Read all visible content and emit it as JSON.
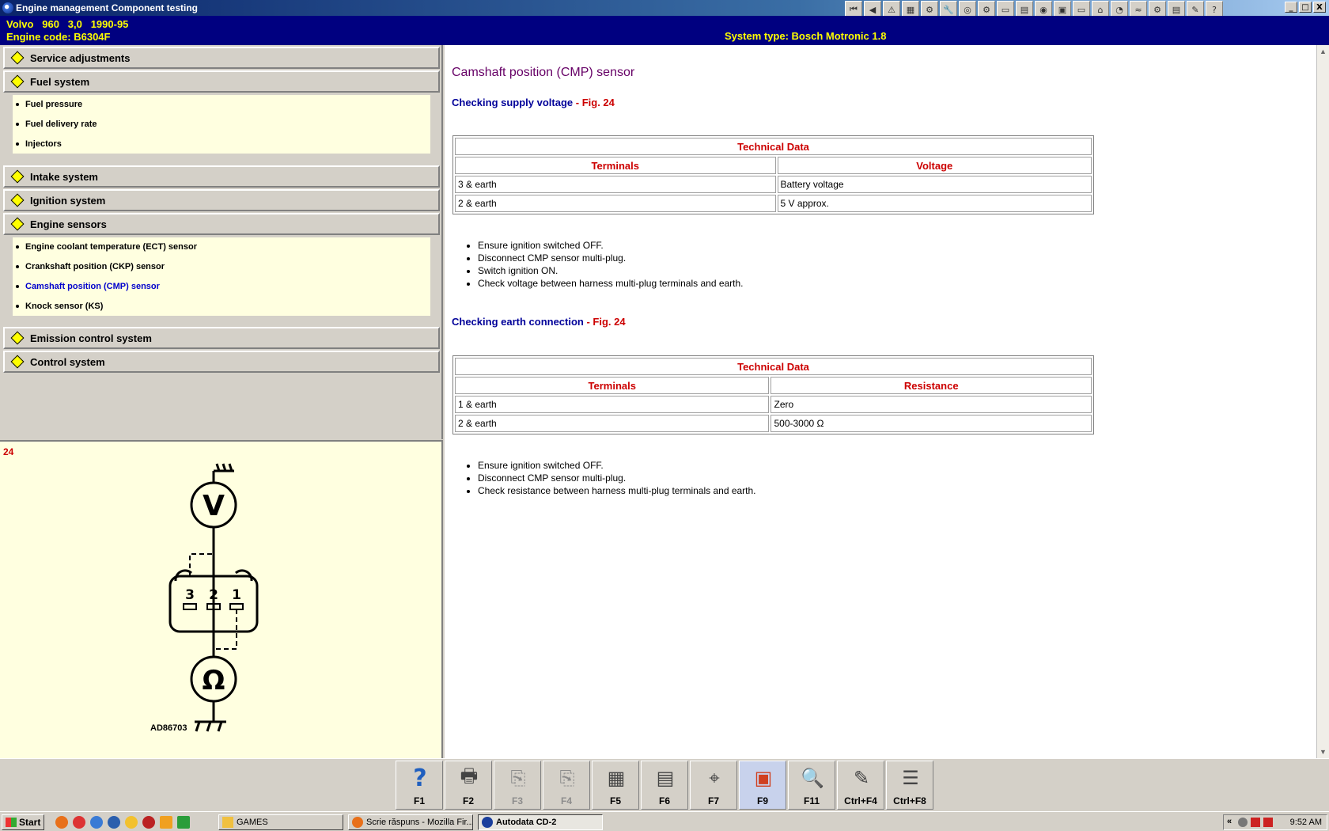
{
  "window": {
    "title": "Engine management Component testing",
    "minimize": "_",
    "maximize": "□",
    "close": "X"
  },
  "toolbar_icons": [
    "first-page-icon",
    "prev-page-icon",
    "warning-icon",
    "diagram-icon",
    "engine-icon",
    "tools-icon",
    "wheel-icon",
    "service-icon",
    "battery-icon",
    "filter-icon",
    "lamp-icon",
    "component-icon",
    "vehicle-icon",
    "car-icon",
    "gauge-icon",
    "cable-icon",
    "settings-icon",
    "document-icon",
    "note-icon",
    "help-icon"
  ],
  "header": {
    "vehicle": "Volvo   960   3,0   1990-95",
    "engine_code": "Engine code: B6304F",
    "system_type": "System type: Bosch Motronic 1.8"
  },
  "nav": {
    "sections": [
      {
        "label": "Service adjustments"
      },
      {
        "label": "Fuel system"
      },
      {
        "label": "Intake system"
      },
      {
        "label": "Ignition system"
      },
      {
        "label": "Engine sensors"
      },
      {
        "label": "Emission control system"
      },
      {
        "label": "Control system"
      }
    ],
    "fuel_items": [
      "Fuel pressure",
      "Fuel delivery rate",
      "Injectors"
    ],
    "sensor_items": [
      "Engine coolant temperature (ECT) sensor",
      "Crankshaft position (CKP) sensor",
      "Camshaft position (CMP) sensor",
      "Knock sensor (KS)"
    ]
  },
  "figure": {
    "number": "24",
    "ref": "AD86703",
    "terminal_labels": [
      "3",
      "2",
      "1"
    ],
    "voltmeter": "V",
    "ohmmeter": "Ω"
  },
  "content": {
    "title": "Camshaft position (CMP) sensor",
    "section1": {
      "title": "Checking supply voltage",
      "fig": " - Fig. 24",
      "table_title": "Technical Data",
      "headers": [
        "Terminals",
        "Voltage"
      ],
      "rows": [
        [
          "3 & earth",
          "Battery voltage"
        ],
        [
          "2 & earth",
          "5 V approx."
        ]
      ],
      "steps": [
        "Ensure ignition switched OFF.",
        "Disconnect CMP sensor multi-plug.",
        "Switch ignition ON.",
        "Check voltage between harness multi-plug terminals and earth."
      ]
    },
    "section2": {
      "title": "Checking earth connection",
      "fig": " - Fig. 24",
      "table_title": "Technical Data",
      "headers": [
        "Terminals",
        "Resistance"
      ],
      "rows": [
        [
          "1 & earth",
          "Zero"
        ],
        [
          "2 & earth",
          "500-3000 Ω"
        ]
      ],
      "steps": [
        "Ensure ignition switched OFF.",
        "Disconnect CMP sensor multi-plug.",
        "Check resistance between harness multi-plug terminals and earth."
      ]
    }
  },
  "fkeys": [
    {
      "label": "F1",
      "icon": "help-icon",
      "glyph": "?"
    },
    {
      "label": "F2",
      "icon": "print-icon",
      "glyph": "🖶"
    },
    {
      "label": "F3",
      "icon": "copy-icon",
      "glyph": "⎘"
    },
    {
      "label": "F4",
      "icon": "paste-icon",
      "glyph": "⎘"
    },
    {
      "label": "F5",
      "icon": "component-location-icon",
      "glyph": "▦"
    },
    {
      "label": "F6",
      "icon": "wiring-icon",
      "glyph": "▤"
    },
    {
      "label": "F7",
      "icon": "search-icon",
      "glyph": "⌖"
    },
    {
      "label": "F9",
      "icon": "fault-code-icon",
      "glyph": "▣"
    },
    {
      "label": "F11",
      "icon": "zoom-icon",
      "glyph": "🔍"
    },
    {
      "label": "Ctrl+F4",
      "icon": "notes-icon",
      "glyph": "✎"
    },
    {
      "label": "Ctrl+F8",
      "icon": "index-icon",
      "glyph": "☰"
    }
  ],
  "taskbar": {
    "start": "Start",
    "tasks": [
      "GAMES",
      "Scrie răspuns - Mozilla Fir...",
      "Autodata CD-2"
    ],
    "tray_chevron": "«",
    "clock": "9:52 AM"
  }
}
